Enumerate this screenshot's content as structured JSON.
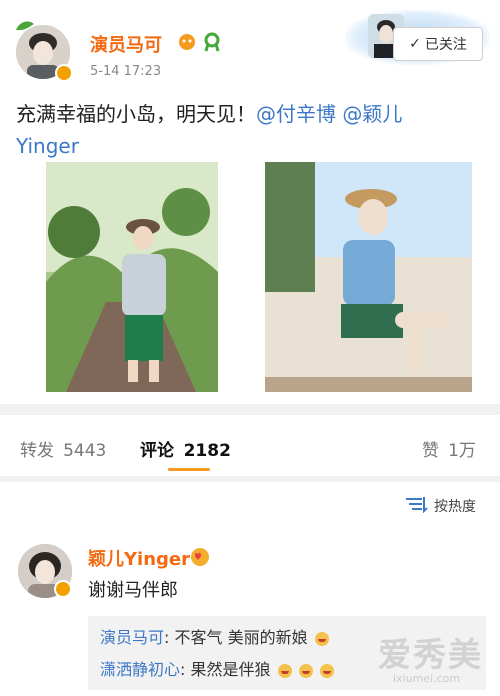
{
  "post": {
    "author_name": "演员马可",
    "timestamp": "5-14 17:23",
    "follow_label": "已关注",
    "text_line1": "充满幸福的小岛，明天见！",
    "mention1": "@付辛博",
    "mention2": "@颖儿",
    "text_line2": "Yinger"
  },
  "stats": {
    "reposts_label": "转发",
    "reposts_count": "5443",
    "comments_label": "评论",
    "comments_count": "2182",
    "likes_label": "赞",
    "likes_count": "1万"
  },
  "sort": {
    "label": "按热度"
  },
  "comment": {
    "author_name": "颖儿Yinger",
    "text": "谢谢马伴郎",
    "replies": [
      {
        "name": "演员马可",
        "text": "不客气 美丽的新娘"
      },
      {
        "name": "潇洒静初心",
        "text": "果然是伴狼"
      }
    ]
  },
  "watermark": {
    "big": "爱秀美",
    "small": "ixiumei.com"
  },
  "colors": {
    "accent_orange": "#f36a12",
    "link_blue": "#3c78c6",
    "verified_badge": "#f2a000"
  }
}
